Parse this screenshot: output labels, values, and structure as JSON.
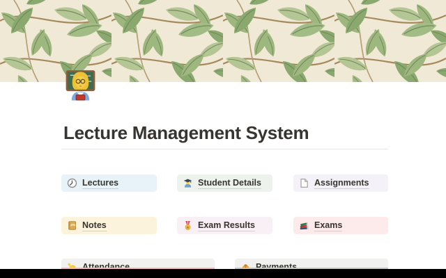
{
  "page": {
    "title": "Lecture Management System",
    "icon": "woman-teacher-emoji",
    "cover": "green-willow-leaf-pattern"
  },
  "cards": [
    {
      "label": "Lectures",
      "icon": "clock-icon",
      "bg": "#e7f3f8"
    },
    {
      "label": "Student Details",
      "icon": "student-emoji-icon",
      "bg": "#edf3ec"
    },
    {
      "label": "Assignments",
      "icon": "document-icon",
      "bg": "#f4f1f8"
    },
    {
      "label": "Notes",
      "icon": "notebook-emoji-icon",
      "bg": "#fbf3db"
    },
    {
      "label": "Exam Results",
      "icon": "medal-emoji-icon",
      "bg": "#f9f0f5"
    },
    {
      "label": "Exams",
      "icon": "books-emoji-icon",
      "bg": "#fdebec"
    },
    {
      "label": "Attendance",
      "icon": "person-raising-hand-emoji-icon",
      "bg": "#f1f1ef",
      "cut_line_color": "#f3b9be"
    },
    {
      "label": "Payments",
      "icon": "money-bag-emoji-icon",
      "bg": "#f1f1ef",
      "cut_line_color": "#c9c8c5"
    }
  ],
  "colors": {
    "title_text": "#37352f",
    "divider": "#e7e6e3",
    "cover_background": "#f0e9d6",
    "leaf_green_1": "#9db77f",
    "leaf_green_2": "#8aa96e",
    "leaf_green_3": "#b3c694",
    "branch_brown": "#a78a5c",
    "letterbox": "#000000"
  }
}
